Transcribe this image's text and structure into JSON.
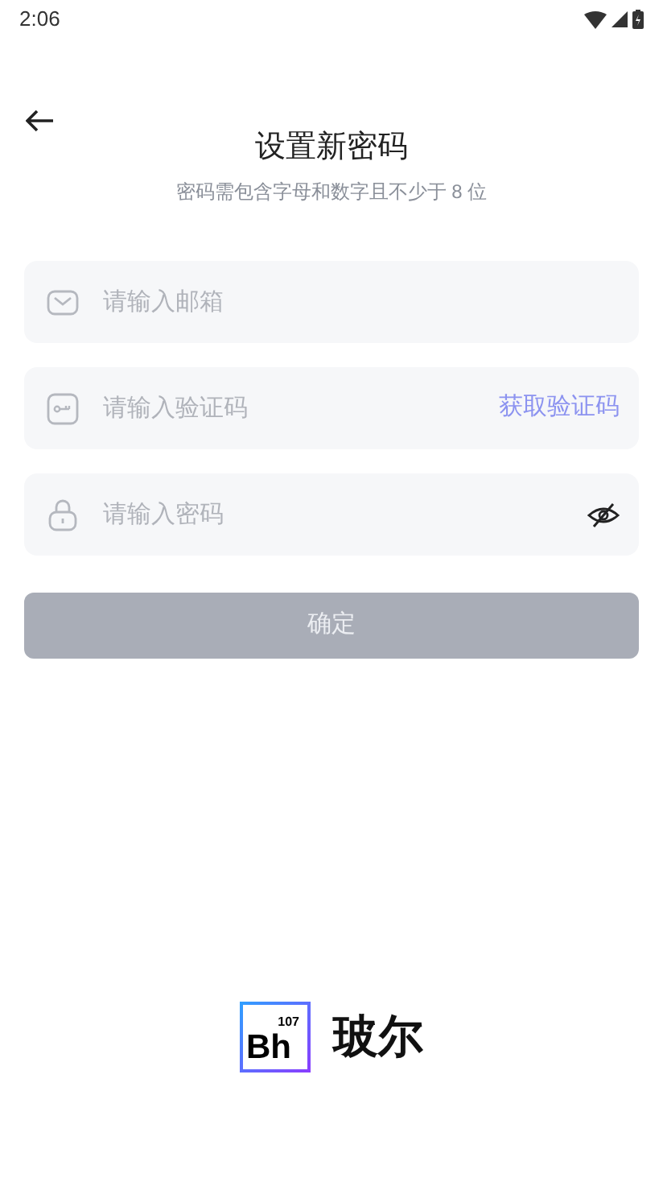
{
  "status_bar": {
    "time": "2:06"
  },
  "header": {
    "title": "设置新密码",
    "subtitle": "密码需包含字母和数字且不少于 8 位"
  },
  "fields": [
    {
      "kind": "email",
      "placeholder": "请输入邮箱"
    },
    {
      "kind": "code",
      "placeholder": "请输入验证码",
      "action": "获取验证码"
    },
    {
      "kind": "password",
      "placeholder": "请输入密码",
      "masked": true
    }
  ],
  "submit": {
    "label": "确定",
    "disabled": true
  },
  "logo": {
    "number": "107",
    "symbol": "Bh",
    "name": "玻尔"
  }
}
